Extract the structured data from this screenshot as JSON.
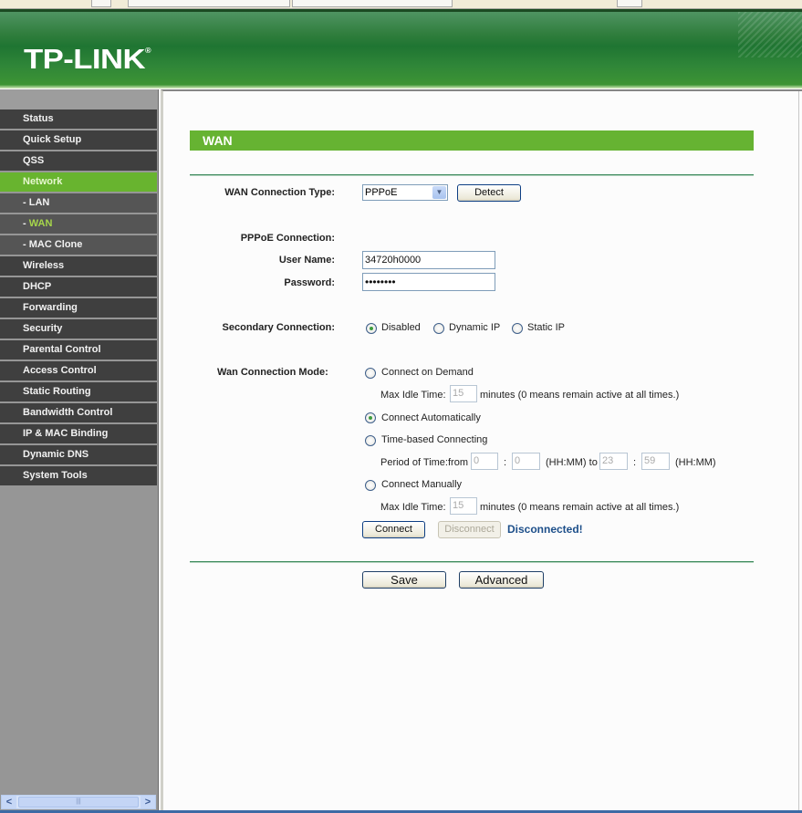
{
  "header": {
    "logo": "TP-LINK",
    "logo_mark": "®"
  },
  "sidebar": {
    "items": [
      {
        "label": "Status",
        "state": "normal"
      },
      {
        "label": "Quick Setup",
        "state": "normal"
      },
      {
        "label": "QSS",
        "state": "normal"
      },
      {
        "label": "Network",
        "state": "active"
      },
      {
        "label": "- LAN",
        "state": "sub"
      },
      {
        "label": "- WAN",
        "state": "sub-current"
      },
      {
        "label": "- MAC Clone",
        "state": "sub"
      },
      {
        "label": "Wireless",
        "state": "normal"
      },
      {
        "label": "DHCP",
        "state": "normal"
      },
      {
        "label": "Forwarding",
        "state": "normal"
      },
      {
        "label": "Security",
        "state": "normal"
      },
      {
        "label": "Parental Control",
        "state": "normal"
      },
      {
        "label": "Access Control",
        "state": "normal"
      },
      {
        "label": "Static Routing",
        "state": "normal"
      },
      {
        "label": "Bandwidth Control",
        "state": "normal"
      },
      {
        "label": "IP & MAC Binding",
        "state": "normal"
      },
      {
        "label": "Dynamic DNS",
        "state": "normal"
      },
      {
        "label": "System Tools",
        "state": "normal"
      }
    ],
    "scroll_left": "<",
    "scroll_right": ">",
    "scroll_grip": "|||"
  },
  "page": {
    "title": "WAN",
    "wan_type": {
      "label": "WAN Connection Type:",
      "value": "PPPoE",
      "detect_label": "Detect"
    },
    "pppoe": {
      "section_label": "PPPoE Connection:",
      "username_label": "User Name:",
      "username_value": "34720h0000",
      "password_label": "Password:",
      "password_value": "••••••••"
    },
    "secondary": {
      "label": "Secondary Connection:",
      "options": [
        "Disabled",
        "Dynamic IP",
        "Static IP"
      ],
      "selected": "Disabled"
    },
    "mode": {
      "label": "Wan Connection Mode:",
      "on_demand": "Connect on Demand",
      "max_idle_label": "Max Idle Time:",
      "max_idle_value_1": "15",
      "minutes_note": "minutes (0 means remain active at all times.)",
      "auto": "Connect Automatically",
      "time_based": "Time-based Connecting",
      "period_label": "Period of Time:from",
      "from_hh": "0",
      "from_mm": "0",
      "colon": ":",
      "hhmm_to": "(HH:MM) to",
      "to_hh": "23",
      "to_mm": "59",
      "hhmm": "(HH:MM)",
      "manual": "Connect Manually",
      "max_idle_value_2": "15",
      "selected": "Connect Automatically"
    },
    "connect_label": "Connect",
    "disconnect_label": "Disconnect",
    "status_text": "Disconnected!",
    "save_label": "Save",
    "advanced_label": "Advanced"
  }
}
